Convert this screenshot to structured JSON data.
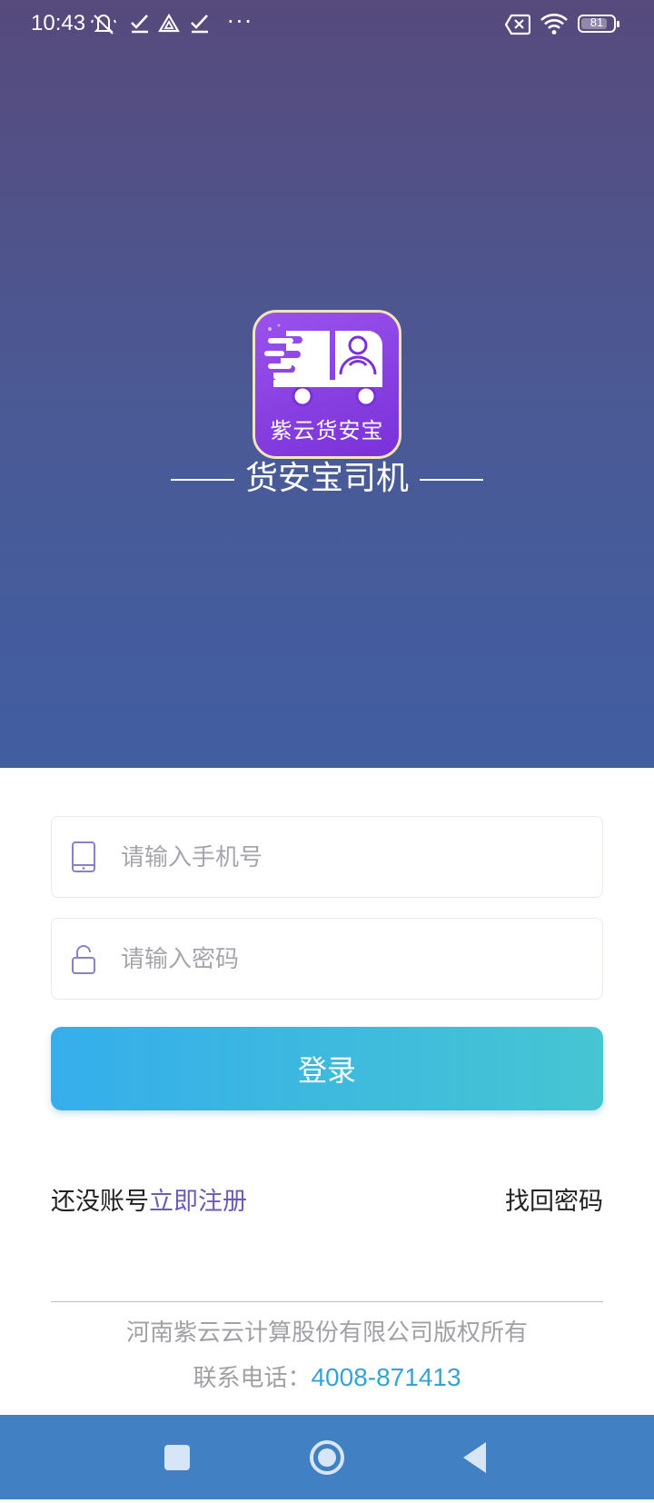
{
  "status_bar": {
    "time": "10:43",
    "battery": "81",
    "battery_level": 0.81,
    "more_indicator": "···",
    "icons": [
      "mute-vibrate-icon",
      "check-icon",
      "drive-icon",
      "check-icon",
      "no-sim-icon",
      "wifi-icon",
      "battery-icon"
    ]
  },
  "app": {
    "icon_text": "紫云货安宝",
    "title": "货安宝司机"
  },
  "login": {
    "phone_placeholder": "请输入手机号",
    "password_placeholder": "请输入密码",
    "login_button": "登录",
    "no_account_text": "还没账号",
    "register_link": "立即注册",
    "forgot_password": "找回密码"
  },
  "footer": {
    "copyright": "河南紫云云计算股份有限公司版权所有",
    "contact_label": "联系电话：",
    "phone_number": "4008-871413"
  },
  "navbar": {
    "buttons": [
      "recents-button",
      "home-button",
      "back-button"
    ]
  },
  "colors": {
    "hero_top": "#574a7c",
    "hero_bottom": "#415ea1",
    "button_start": "#35aeeb",
    "button_end": "#46c5d2",
    "register_link": "#6b5bb6",
    "phone_link": "#35a3d6",
    "navbar": "#4080c3"
  }
}
